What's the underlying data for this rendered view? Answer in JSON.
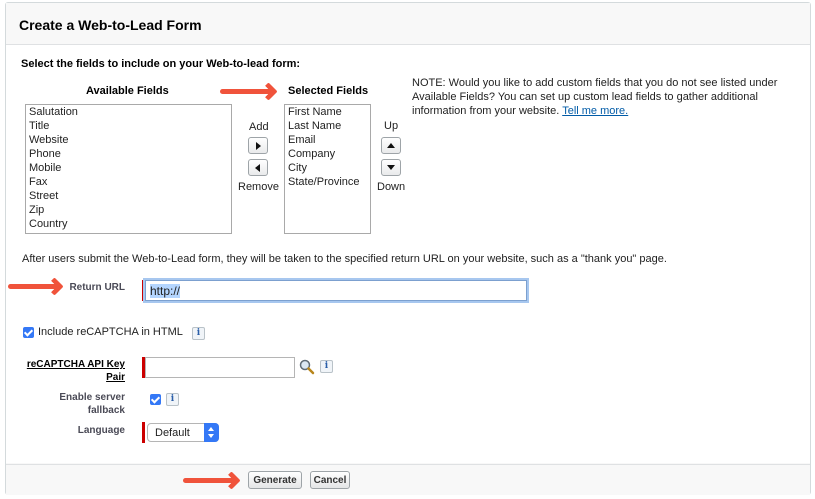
{
  "header": {
    "title": "Create a Web-to-Lead Form"
  },
  "section": {
    "instruction": "Select the fields to include on your Web-to-lead form:"
  },
  "available": {
    "heading": "Available Fields",
    "items": [
      "Salutation",
      "Title",
      "Website",
      "Phone",
      "Mobile",
      "Fax",
      "Street",
      "Zip",
      "Country"
    ]
  },
  "selected": {
    "heading": "Selected Fields",
    "items": [
      "First Name",
      "Last Name",
      "Email",
      "Company",
      "City",
      "State/Province"
    ]
  },
  "move": {
    "add_label": "Add",
    "remove_label": "Remove",
    "up_label": "Up",
    "down_label": "Down"
  },
  "note": {
    "text": "NOTE: Would you like to add custom fields that you do not see listed under Available Fields? You can set up custom lead fields to gather additional information from your website.",
    "link": "Tell me more."
  },
  "return_info": "After users submit the Web-to-Lead form, they will be taken to the specified return URL on your website, such as a \"thank you\" page.",
  "return_url": {
    "label": "Return URL",
    "value": "http://"
  },
  "recaptcha": {
    "include_label": "Include reCAPTCHA in HTML",
    "include_checked": true,
    "info_glyph": "i"
  },
  "api_key": {
    "label_line1": "reCAPTCHA API Key",
    "label_line2": "Pair",
    "value": ""
  },
  "server_fallback": {
    "label_line1": "Enable server",
    "label_line2": "fallback",
    "checked": true
  },
  "language": {
    "label": "Language",
    "value": "Default"
  },
  "footer": {
    "generate_label": "Generate",
    "cancel_label": "Cancel"
  },
  "colors": {
    "annotation_arrow": "#f0533b",
    "required_bar": "#cc0000",
    "checkbox": "#3478f6"
  },
  "icons": {
    "add": "triangle-right-icon",
    "remove": "triangle-left-icon",
    "up": "triangle-up-icon",
    "down": "triangle-down-icon",
    "lookup": "magnifier-icon",
    "info": "info-icon",
    "select": "updown-chevron-icon"
  }
}
